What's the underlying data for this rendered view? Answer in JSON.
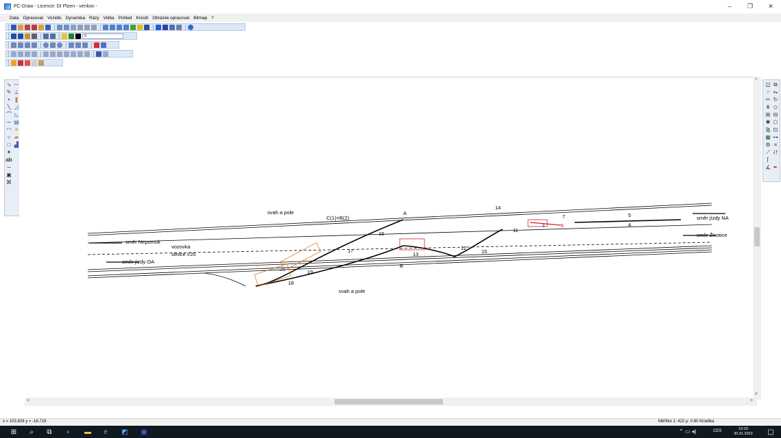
{
  "window": {
    "title": "PC-Draw - Licence: DI Plzen - venkov -",
    "minimize_glyph": "–",
    "maximize_glyph": "❐",
    "close_glyph": "✕"
  },
  "menu": [
    "Data",
    "Opracovat",
    "Vozidlo",
    "Dynamika",
    "Rázy",
    "Volba",
    "Pohled",
    "Kreslit",
    "Obrázek opracovat",
    "Bitmap",
    "?"
  ],
  "toolbar": {
    "line_width_value": "0"
  },
  "drawing": {
    "labels": {
      "svah_top": "svah a pole",
      "svah_bottom": "svah a pole",
      "smer_nepomuk": "směr Nepomuk",
      "smer_oa": "směr jízdy OA",
      "smer_na": "směr jízdy NA",
      "smer_zivotice": "směr Životice",
      "vozovka": "vozovka",
      "silnice": "silnice I/20",
      "point_a": "A",
      "point_b": "B",
      "c_eq": "C(1)=B(2)",
      "n14": "14",
      "n16": "16",
      "n17": "17",
      "n12": "12",
      "n11": "11",
      "n15": "15",
      "n13": "13",
      "n18": "18",
      "n19": "19",
      "n20": "20",
      "n3": "3",
      "n4": "4",
      "n5": "5",
      "n6": "6",
      "n7": "7"
    }
  },
  "statusbar": {
    "coords": "x = 103.826 y = -16.719",
    "scale": "Měřítko 1: 422   µ: 0.80  Kinetika"
  },
  "taskbar": {
    "time": "10:33",
    "date": "30.01.2022",
    "lang": "CES"
  },
  "colors": {
    "toolbar_bg": "#dce8f8",
    "taskbar_bg": "#101820",
    "accent_red": "#d02020",
    "accent_orange": "#e07a20",
    "accent_blue": "#2040c0"
  }
}
